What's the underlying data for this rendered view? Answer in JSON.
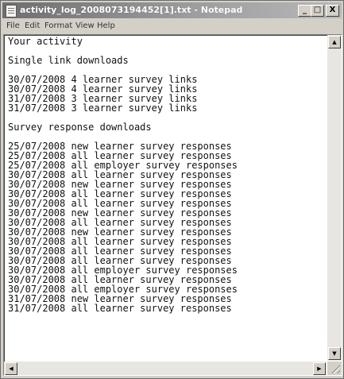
{
  "window": {
    "title": "activity_log_2008073194452[1].txt - Notepad",
    "min_glyph": "_",
    "max_glyph": "□",
    "close_glyph": "X"
  },
  "menu": {
    "file": "File",
    "edit": "Edit",
    "format": "Format",
    "view": "View",
    "help": "Help"
  },
  "document": {
    "lines": [
      "Your activity",
      "",
      "Single link downloads",
      "",
      "30/07/2008 4 learner survey links",
      "30/07/2008 4 learner survey links",
      "31/07/2008 3 learner survey links",
      "31/07/2008 3 learner survey links",
      "",
      "Survey response downloads",
      "",
      "25/07/2008 new learner survey responses",
      "25/07/2008 all learner survey responses",
      "25/07/2008 all employer survey responses",
      "30/07/2008 all learner survey responses",
      "30/07/2008 new learner survey responses",
      "30/07/2008 all learner survey responses",
      "30/07/2008 all learner survey responses",
      "30/07/2008 new learner survey responses",
      "30/07/2008 all learner survey responses",
      "30/07/2008 new learner survey responses",
      "30/07/2008 all learner survey responses",
      "30/07/2008 all learner survey responses",
      "30/07/2008 all learner survey responses",
      "30/07/2008 all employer survey responses",
      "30/07/2008 all learner survey responses",
      "30/07/2008 all employer survey responses",
      "31/07/2008 new learner survey responses",
      "31/07/2008 all learner survey responses"
    ]
  },
  "scrollbars": {
    "up_glyph": "▲",
    "down_glyph": "▼",
    "left_glyph": "◀",
    "right_glyph": "▶"
  }
}
